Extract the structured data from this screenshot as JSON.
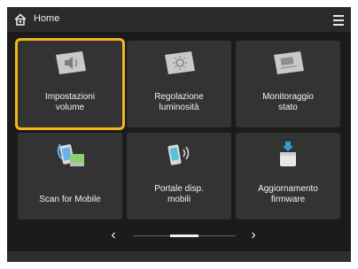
{
  "header": {
    "title": "Home",
    "home_icon": "home-icon",
    "menu_icon": "menu-icon"
  },
  "tiles": [
    {
      "label": "Impostazioni\nvolume",
      "icon": "speaker-volume-icon",
      "selected": true
    },
    {
      "label": "Regolazione\nluminosità",
      "icon": "brightness-icon",
      "selected": false
    },
    {
      "label": "Monitoraggio\nstato",
      "icon": "status-monitor-icon",
      "selected": false
    },
    {
      "label": "Scan for Mobile",
      "icon": "scan-to-mobile-icon",
      "selected": false
    },
    {
      "label": "Portale disp.\nmobili",
      "icon": "mobile-portal-icon",
      "selected": false
    },
    {
      "label": "Aggiornamento\nfirmware",
      "icon": "firmware-update-icon",
      "selected": false
    }
  ],
  "pager": {
    "prev": "‹",
    "next": "›",
    "page": 2,
    "page_count": 3
  },
  "colors": {
    "background": "#1b1b1b",
    "tile": "#333333",
    "selection": "#f3b61d",
    "text": "#f2f2f2"
  }
}
